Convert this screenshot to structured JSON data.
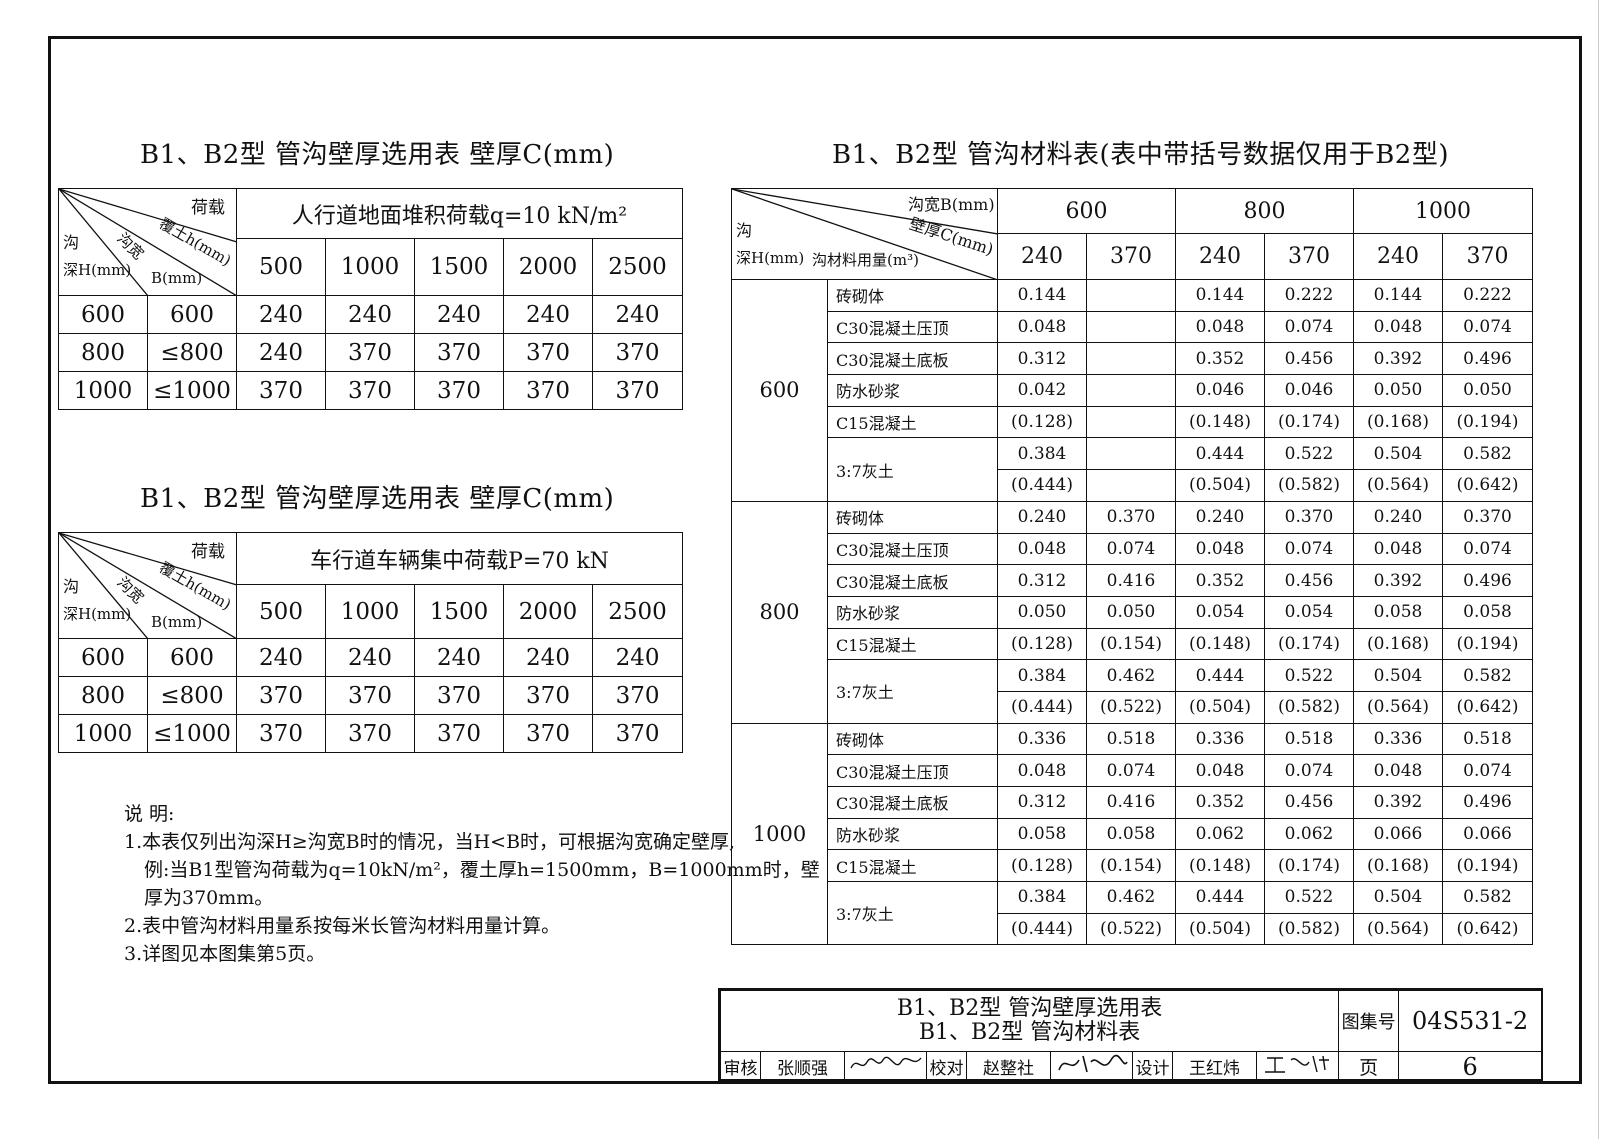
{
  "table1": {
    "title": "B1、B2型  管沟壁厚选用表    壁厚C(mm)",
    "hdr": {
      "load": "荷载",
      "cover": "覆土h(mm)",
      "gou": "沟",
      "width": "沟宽",
      "depth": "深H(mm)",
      "b": "B(mm)"
    },
    "span": "人行道地面堆积荷载q=10 kN/m²",
    "cols": [
      "500",
      "1000",
      "1500",
      "2000",
      "2500"
    ],
    "rows": [
      {
        "h": "600",
        "b": "600",
        "v": [
          "240",
          "240",
          "240",
          "240",
          "240"
        ]
      },
      {
        "h": "800",
        "b": "≤800",
        "v": [
          "240",
          "370",
          "370",
          "370",
          "370"
        ]
      },
      {
        "h": "1000",
        "b": "≤1000",
        "v": [
          "370",
          "370",
          "370",
          "370",
          "370"
        ]
      }
    ]
  },
  "table2": {
    "title": "B1、B2型  管沟壁厚选用表    壁厚C(mm)",
    "hdr": {
      "load": "荷载",
      "cover": "覆土h(mm)",
      "gou": "沟",
      "width": "沟宽",
      "depth": "深H(mm)",
      "b": "B(mm)"
    },
    "span": "车行道车辆集中荷载P=70 kN",
    "cols": [
      "500",
      "1000",
      "1500",
      "2000",
      "2500"
    ],
    "rows": [
      {
        "h": "600",
        "b": "600",
        "v": [
          "240",
          "240",
          "240",
          "240",
          "240"
        ]
      },
      {
        "h": "800",
        "b": "≤800",
        "v": [
          "370",
          "370",
          "370",
          "370",
          "370"
        ]
      },
      {
        "h": "1000",
        "b": "≤1000",
        "v": [
          "370",
          "370",
          "370",
          "370",
          "370"
        ]
      }
    ]
  },
  "table3": {
    "title": "B1、B2型  管沟材料表(表中带括号数据仅用于B2型)",
    "hdr": {
      "width": "沟宽B(mm)",
      "wall": "壁厚C(mm)",
      "gou": "沟",
      "depth": "深H(mm)",
      "qty": "沟材料用量(m³)"
    },
    "widths": [
      "600",
      "800",
      "1000"
    ],
    "walls": [
      "240",
      "370",
      "240",
      "370",
      "240",
      "370"
    ],
    "groups": [
      {
        "depth": "600",
        "rows": [
          {
            "m": "砖砌体",
            "v": [
              "0.144",
              "",
              "0.144",
              "0.222",
              "0.144",
              "0.222"
            ]
          },
          {
            "m": "C30混凝土压顶",
            "v": [
              "0.048",
              "",
              "0.048",
              "0.074",
              "0.048",
              "0.074"
            ]
          },
          {
            "m": "C30混凝土底板",
            "v": [
              "0.312",
              "",
              "0.352",
              "0.456",
              "0.392",
              "0.496"
            ]
          },
          {
            "m": "防水砂浆",
            "v": [
              "0.042",
              "",
              "0.046",
              "0.046",
              "0.050",
              "0.050"
            ]
          },
          {
            "m": "C15混凝土",
            "v": [
              "(0.128)",
              "",
              "(0.148)",
              "(0.174)",
              "(0.168)",
              "(0.194)"
            ]
          },
          {
            "m": "3:7灰土",
            "v": [
              "0.384",
              "",
              "0.444",
              "0.522",
              "0.504",
              "0.582"
            ],
            "v2": [
              "(0.444)",
              "",
              "(0.504)",
              "(0.582)",
              "(0.564)",
              "(0.642)"
            ]
          }
        ]
      },
      {
        "depth": "800",
        "rows": [
          {
            "m": "砖砌体",
            "v": [
              "0.240",
              "0.370",
              "0.240",
              "0.370",
              "0.240",
              "0.370"
            ]
          },
          {
            "m": "C30混凝土压顶",
            "v": [
              "0.048",
              "0.074",
              "0.048",
              "0.074",
              "0.048",
              "0.074"
            ]
          },
          {
            "m": "C30混凝土底板",
            "v": [
              "0.312",
              "0.416",
              "0.352",
              "0.456",
              "0.392",
              "0.496"
            ]
          },
          {
            "m": "防水砂浆",
            "v": [
              "0.050",
              "0.050",
              "0.054",
              "0.054",
              "0.058",
              "0.058"
            ]
          },
          {
            "m": "C15混凝土",
            "v": [
              "(0.128)",
              "(0.154)",
              "(0.148)",
              "(0.174)",
              "(0.168)",
              "(0.194)"
            ]
          },
          {
            "m": "3:7灰土",
            "v": [
              "0.384",
              "0.462",
              "0.444",
              "0.522",
              "0.504",
              "0.582"
            ],
            "v2": [
              "(0.444)",
              "(0.522)",
              "(0.504)",
              "(0.582)",
              "(0.564)",
              "(0.642)"
            ]
          }
        ]
      },
      {
        "depth": "1000",
        "rows": [
          {
            "m": "砖砌体",
            "v": [
              "0.336",
              "0.518",
              "0.336",
              "0.518",
              "0.336",
              "0.518"
            ]
          },
          {
            "m": "C30混凝土压顶",
            "v": [
              "0.048",
              "0.074",
              "0.048",
              "0.074",
              "0.048",
              "0.074"
            ]
          },
          {
            "m": "C30混凝土底板",
            "v": [
              "0.312",
              "0.416",
              "0.352",
              "0.456",
              "0.392",
              "0.496"
            ]
          },
          {
            "m": "防水砂浆",
            "v": [
              "0.058",
              "0.058",
              "0.062",
              "0.062",
              "0.066",
              "0.066"
            ]
          },
          {
            "m": "C15混凝土",
            "v": [
              "(0.128)",
              "(0.154)",
              "(0.148)",
              "(0.174)",
              "(0.168)",
              "(0.194)"
            ]
          },
          {
            "m": "3:7灰土",
            "v": [
              "0.384",
              "0.462",
              "0.444",
              "0.522",
              "0.504",
              "0.582"
            ],
            "v2": [
              "(0.444)",
              "(0.522)",
              "(0.504)",
              "(0.582)",
              "(0.564)",
              "(0.642)"
            ]
          }
        ]
      }
    ]
  },
  "notes": {
    "heading": "说 明:",
    "lines": [
      "1.本表仅列出沟深H≥沟宽B时的情况，当H<B时，可根据沟宽确定壁厚,",
      "例:当B1型管沟荷载为q=10kN/m²，覆土厚h=1500mm，B=1000mm时，壁",
      "厚为370mm。",
      "2.表中管沟材料用量系按每米长管沟材料用量计算。",
      "3.详图见本图集第5页。"
    ]
  },
  "titleblock": {
    "name1": "B1、B2型  管沟壁厚选用表",
    "name2": "B1、B2型  管沟材料表",
    "atlas_label": "图集号",
    "atlas_no": "04S531-2",
    "review_label": "审核",
    "reviewer": "张顺强",
    "check_label": "校对",
    "checker": "赵整社",
    "design_label": "设计",
    "designer": "王红炜",
    "page_label": "页",
    "page_no": "6"
  }
}
